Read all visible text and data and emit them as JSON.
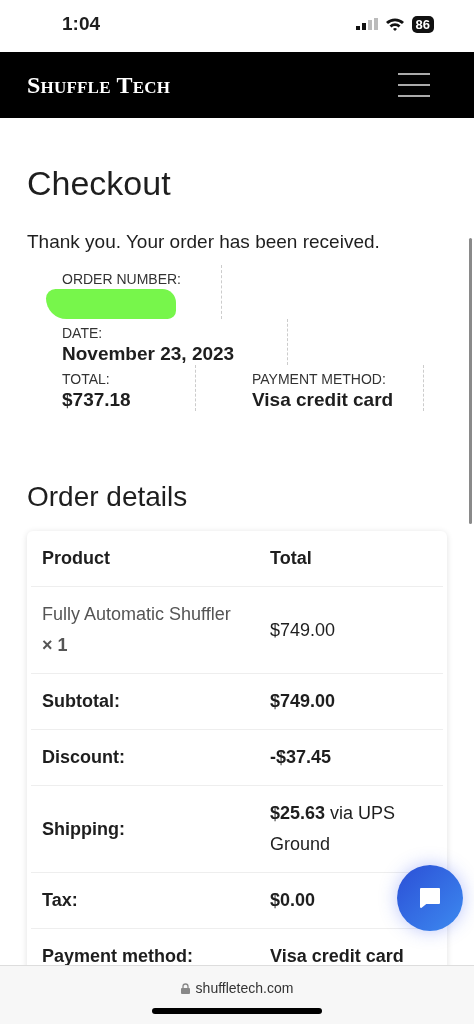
{
  "status_bar": {
    "time": "1:04",
    "battery": "86"
  },
  "header": {
    "logo": "Shuffle Tech"
  },
  "page": {
    "title": "Checkout",
    "message": "Thank you. Your order has been received.",
    "overview": [
      {
        "label": "ORDER NUMBER:",
        "redacted": true
      },
      {
        "label": "DATE:",
        "value": "November 23, 2023",
        "redacted": false
      },
      {
        "label": "TOTAL:",
        "value": "$737.18",
        "redacted": false
      },
      {
        "label": "PAYMENT METHOD:",
        "value": "Visa credit card",
        "redacted": false
      }
    ]
  },
  "order_details": {
    "title": "Order details",
    "columns": [
      "Product",
      "Total"
    ],
    "rows": [
      {
        "kind": "item",
        "label": "Fully Automatic Shuffler **× 1**",
        "value": "$749.00"
      },
      {
        "kind": "total",
        "label": "Subtotal:",
        "value": "**$749.00**"
      },
      {
        "kind": "total",
        "label": "Discount:",
        "value": "**-$37.45**"
      },
      {
        "kind": "total",
        "label": "Shipping:",
        "value": "**$25.63** via UPS Ground"
      },
      {
        "kind": "total",
        "label": "Tax:",
        "value": "**$0.00**"
      },
      {
        "kind": "total",
        "label": "Payment method:",
        "value": "**Visa credit card**"
      }
    ]
  },
  "browser_bar": {
    "url": "shuffletech.com"
  }
}
